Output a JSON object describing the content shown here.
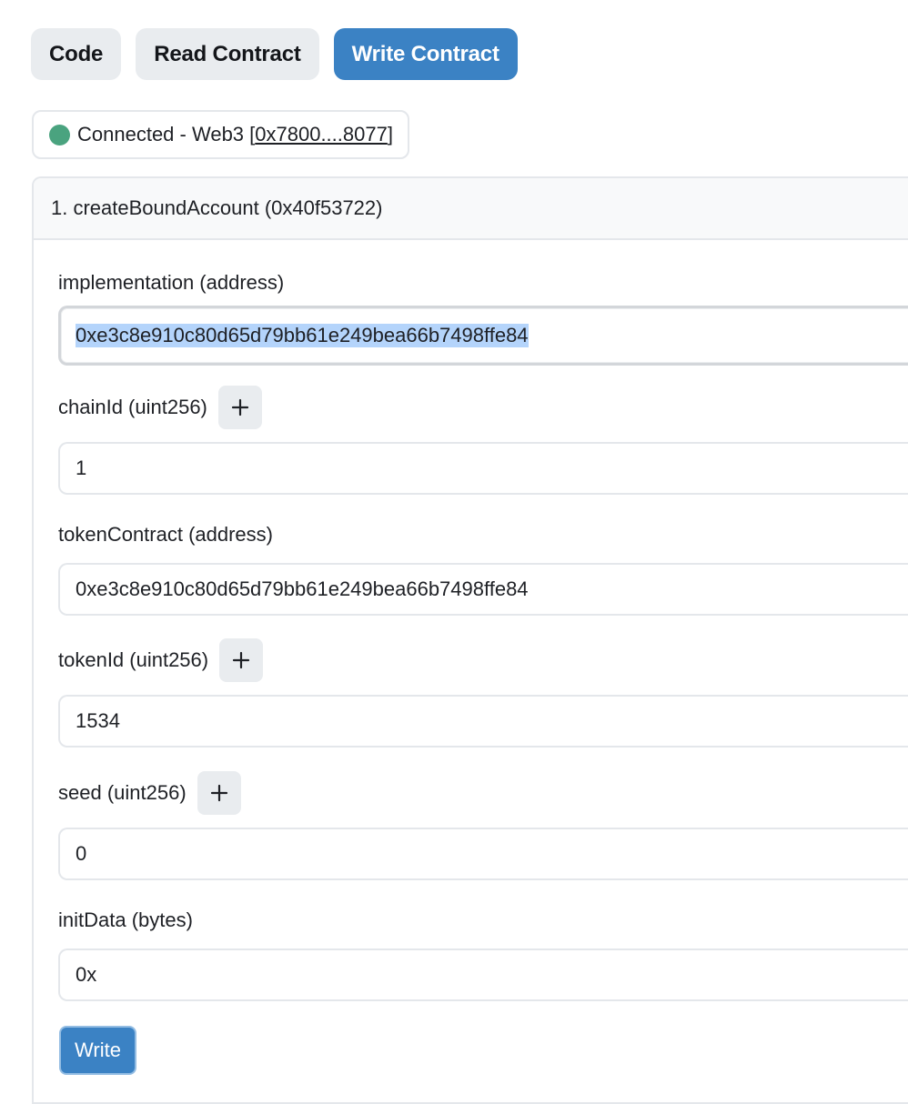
{
  "tabs": [
    {
      "label": "Code",
      "active": false
    },
    {
      "label": "Read Contract",
      "active": false
    },
    {
      "label": "Write Contract",
      "active": true
    }
  ],
  "connection": {
    "status_text": "Connected - Web3 [",
    "address": "0x7800....8077",
    "close_bracket": "]",
    "status_color": "#4aa37f"
  },
  "method": {
    "title": "1. createBoundAccount (0x40f53722)",
    "fields": [
      {
        "label": "implementation (address)",
        "value": "0xe3c8e910c80d65d79bb61e249bea66b7498ffe84",
        "has_add": false
      },
      {
        "label": "chainId (uint256)",
        "value": "1",
        "has_add": true
      },
      {
        "label": "tokenContract (address)",
        "value": "0xe3c8e910c80d65d79bb61e249bea66b7498ffe84",
        "has_add": false
      },
      {
        "label": "tokenId (uint256)",
        "value": "1534",
        "has_add": true
      },
      {
        "label": "seed (uint256)",
        "value": "0",
        "has_add": true
      },
      {
        "label": "initData (bytes)",
        "value": "0x",
        "has_add": false
      }
    ],
    "write_label": "Write"
  },
  "colors": {
    "accent": "#3b82c4",
    "tab_bg": "#e9ecef",
    "selection": "#b4d4fb"
  }
}
